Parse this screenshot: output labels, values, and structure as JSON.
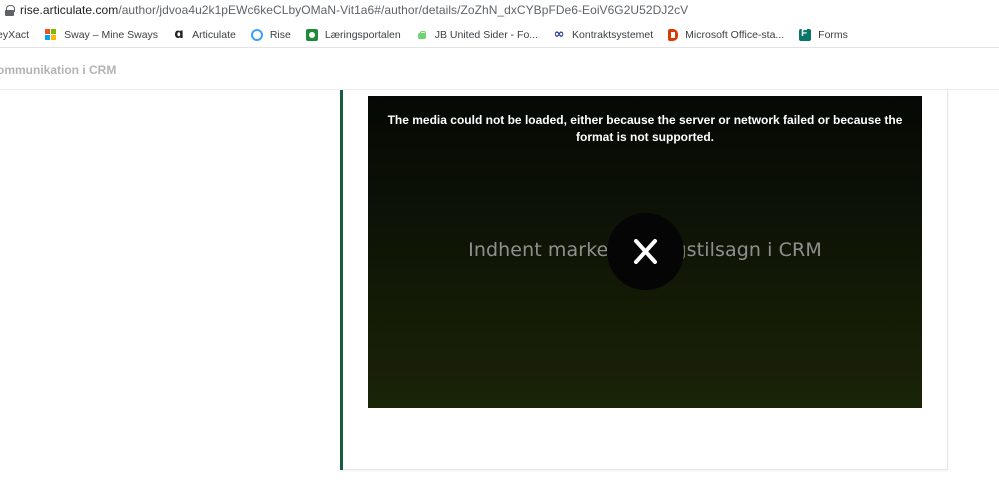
{
  "browser": {
    "url_host": "rise.articulate.com",
    "url_path": "/author/jdvoa4u2k1pEWc6keCLbyOMaN-Vit1a6#/author/details/ZoZhN_dxCYBpFDe6-EoiV6G2U52DJ2cV"
  },
  "bookmarks": [
    {
      "label": "eyXact",
      "icon": "none"
    },
    {
      "label": "Sway – Mine Sways",
      "icon": "microsoft-logo-icon"
    },
    {
      "label": "Articulate",
      "icon": "articulate-logo-icon"
    },
    {
      "label": "Rise",
      "icon": "rise-ring-icon"
    },
    {
      "label": "Læringsportalen",
      "icon": "laeringsportalen-icon"
    },
    {
      "label": "JB United Sider - Fo...",
      "icon": "android-icon"
    },
    {
      "label": "Kontraktsystemet",
      "icon": "infinity-icon"
    },
    {
      "label": "Microsoft Office-sta...",
      "icon": "office-icon"
    },
    {
      "label": "Forms",
      "icon": "forms-icon"
    }
  ],
  "app": {
    "title": "ommunikation i CRM"
  },
  "video": {
    "error_message": "The media could not be loaded, either because the server or network failed or because the format is not supported.",
    "title_text": "Indhent markedsføringstilsagn i CRM"
  },
  "colors": {
    "accent_bar": "#175c3c",
    "video_bg_top": "#050804",
    "video_bg_bottom": "#1a2407"
  }
}
